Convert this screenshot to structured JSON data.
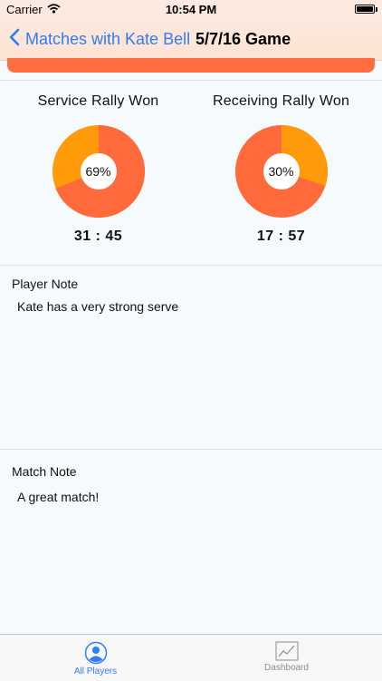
{
  "status_bar": {
    "carrier": "Carrier",
    "time": "10:54 PM"
  },
  "nav": {
    "back_label": "Matches with Kate Bell",
    "title": "5/7/16 Game"
  },
  "stats": [
    {
      "title": "Service Rally Won",
      "percent_label": "69%",
      "percent": 69,
      "score": "31 : 45",
      "major_color": "#ff6a3d",
      "minor_color": "#ff9a0a"
    },
    {
      "title": "Receiving Rally Won",
      "percent_label": "30%",
      "percent": 30,
      "score": "17 : 57",
      "major_color": "#ff9a0a",
      "minor_color": "#ff6a3d"
    }
  ],
  "player_note": {
    "label": "Player Note",
    "text": "Kate has a very strong serve"
  },
  "match_note": {
    "label": "Match Note",
    "text": "A great match!"
  },
  "tabs": [
    {
      "label": "All Players",
      "icon": "person-icon",
      "active": true,
      "color": "#2e7cf6"
    },
    {
      "label": "Dashboard",
      "icon": "chart-icon",
      "active": false,
      "color": "#8e8e93"
    }
  ]
}
